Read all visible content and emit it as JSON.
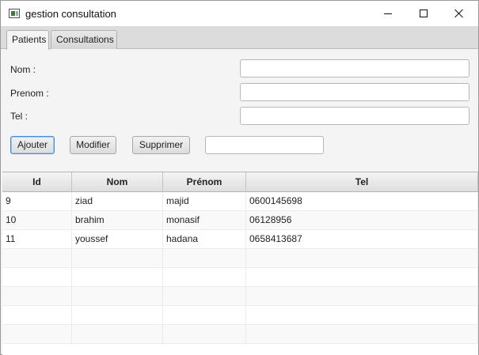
{
  "window": {
    "title": "gestion consultation",
    "icon": "app-window-icon",
    "controls": [
      "minimize-icon",
      "maximize-icon",
      "close-icon"
    ]
  },
  "tabs": [
    {
      "label": "Patients",
      "active": true
    },
    {
      "label": "Consultations",
      "active": false
    }
  ],
  "form": {
    "nom_label": "Nom :",
    "nom_value": "",
    "prenom_label": "Prenom :",
    "prenom_value": "",
    "tel_label": "Tel :",
    "tel_value": "",
    "search_value": ""
  },
  "buttons": {
    "ajouter": "Ajouter",
    "modifier": "Modifier",
    "supprimer": "Supprimer"
  },
  "table": {
    "columns": [
      "Id",
      "Nom",
      "Prénom",
      "Tel"
    ],
    "rows": [
      [
        "9",
        "ziad",
        "majid",
        "0600145698"
      ],
      [
        "10",
        "brahim",
        "monasif",
        "06128956"
      ],
      [
        "11",
        "youssef",
        "hadana",
        "0658413687"
      ]
    ]
  },
  "colors": {
    "focus_border": "#4a8fd6",
    "tab_bar": "#dcdcdc",
    "panel_bg": "#f4f4f4"
  }
}
